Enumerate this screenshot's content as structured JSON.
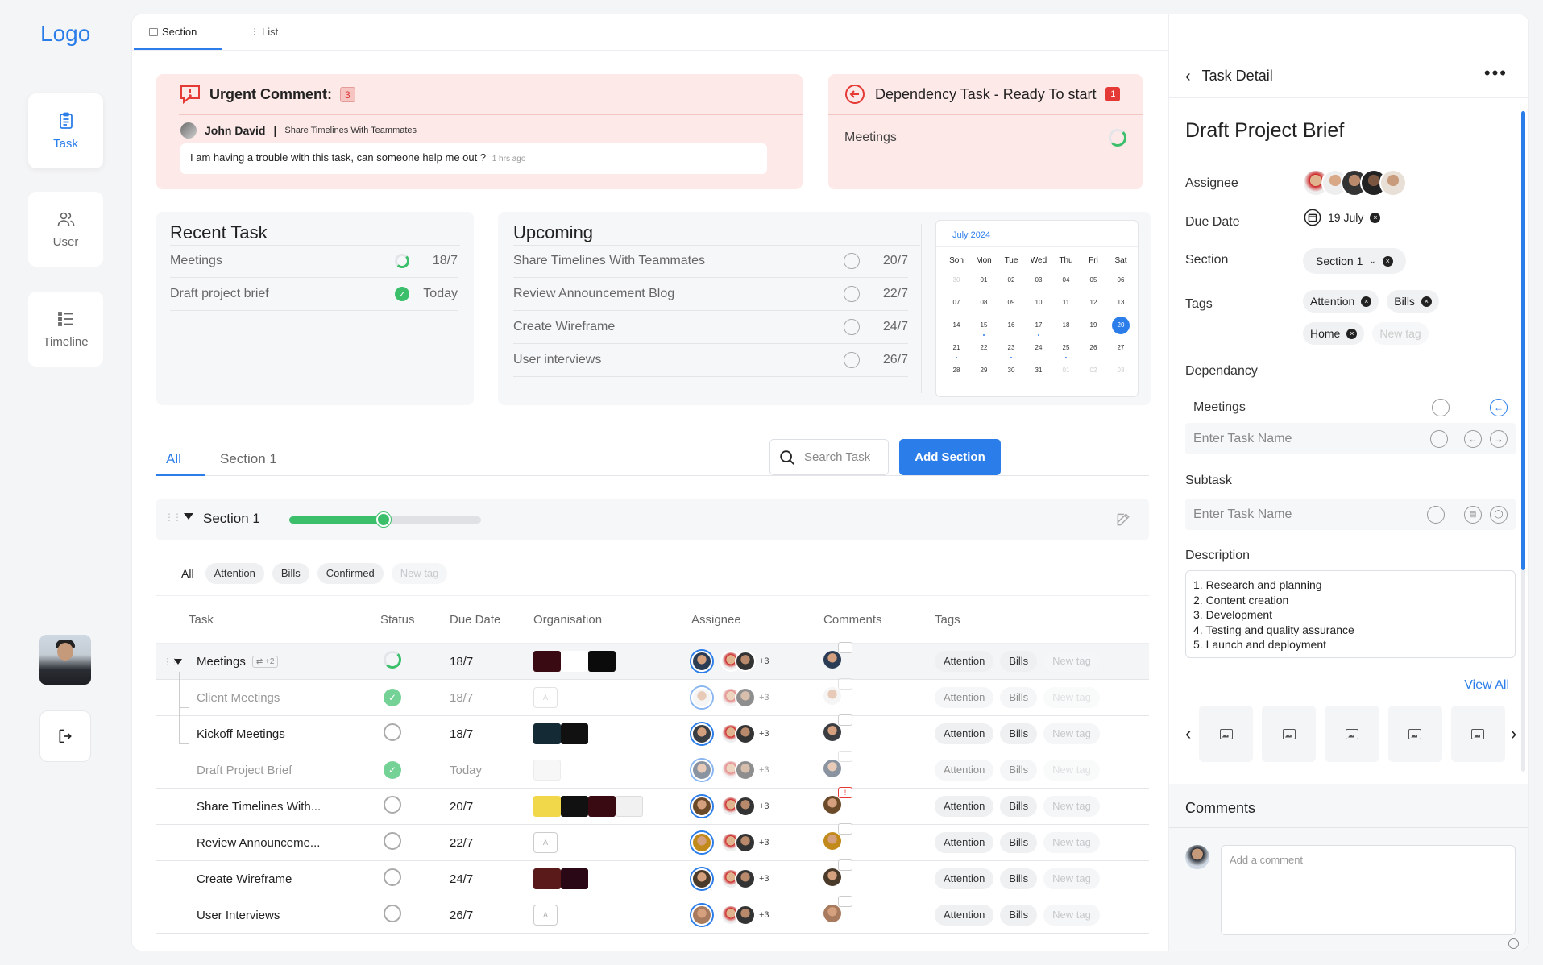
{
  "nav": {
    "logo": "Logo",
    "items": [
      {
        "label": "Task",
        "icon": "clipboard-icon"
      },
      {
        "label": "User",
        "icon": "users-icon"
      },
      {
        "label": "Timeline",
        "icon": "timeline-icon"
      }
    ]
  },
  "topbar": {
    "tabs": [
      {
        "label": "Section"
      },
      {
        "label": "List"
      }
    ]
  },
  "urgent": {
    "title": "Urgent Comment:",
    "count": "3",
    "user": "John David",
    "separator": "|",
    "task": "Share Timelines With Teammates",
    "message": "I am having a trouble with this task, can someone help me out ?",
    "ago": "1 hrs ago"
  },
  "dependency": {
    "title": "Dependency Task - Ready To start",
    "count": "1",
    "item": "Meetings"
  },
  "recent": {
    "title": "Recent Task",
    "items": [
      {
        "name": "Meetings",
        "status": "progress",
        "date": "18/7"
      },
      {
        "name": "Draft project brief",
        "status": "done",
        "date": "Today"
      }
    ]
  },
  "upcoming": {
    "title": "Upcoming",
    "items": [
      {
        "name": "Share Timelines With Teammates",
        "date": "20/7"
      },
      {
        "name": "Review Announcement Blog",
        "date": "22/7"
      },
      {
        "name": "Create Wireframe",
        "date": "24/7"
      },
      {
        "name": "User interviews",
        "date": "26/7"
      }
    ]
  },
  "calendar": {
    "title": "July 2024",
    "weekdays": [
      "Son",
      "Mon",
      "Tue",
      "Wed",
      "Thu",
      "Fri",
      "Sat"
    ],
    "days": [
      "30",
      "01",
      "02",
      "03",
      "04",
      "05",
      "06",
      "07",
      "08",
      "09",
      "10",
      "11",
      "12",
      "13",
      "14",
      "15",
      "16",
      "17",
      "18",
      "19",
      "20",
      "21",
      "22",
      "23",
      "24",
      "25",
      "26",
      "27",
      "28",
      "29",
      "30",
      "31",
      "01",
      "02",
      "03"
    ],
    "selected": "20"
  },
  "tabs": {
    "all": "All",
    "section1": "Section 1"
  },
  "search": {
    "placeholder": "Search Task"
  },
  "add_section": "Add Section",
  "section": {
    "title": "Section 1",
    "progress": 0.49
  },
  "filters": {
    "all": "All",
    "chips": [
      "Attention",
      "Bills",
      "Confirmed",
      "New tag"
    ]
  },
  "table": {
    "columns": [
      "Task",
      "Status",
      "Due Date",
      "Organisation",
      "Assignee",
      "Comments",
      "Tags"
    ],
    "subcount": "+2",
    "more": "+3",
    "tag1": "Attention",
    "tag2": "Bills",
    "tag3": "New tag",
    "rows": [
      {
        "task": "Meetings",
        "date": "18/7"
      },
      {
        "task": "Client Meetings",
        "date": "18/7"
      },
      {
        "task": "Kickoff Meetings",
        "date": "18/7"
      },
      {
        "task": "Draft Project Brief",
        "date": "Today"
      },
      {
        "task": "Share Timelines With...",
        "date": "20/7"
      },
      {
        "task": "Review Announceme...",
        "date": "22/7"
      },
      {
        "task": "Create Wireframe",
        "date": "24/7"
      },
      {
        "task": "User Interviews",
        "date": "26/7"
      }
    ]
  },
  "detail": {
    "header": "Task Detail",
    "title": "Draft Project Brief",
    "assignee_label": "Assignee",
    "due_label": "Due Date",
    "due_value": "19 July",
    "section_label": "Section",
    "section_value": "Section 1",
    "tags_label": "Tags",
    "tags": [
      "Attention",
      "Bills",
      "Home"
    ],
    "new_tag": "New tag",
    "dependency_label": "Dependancy",
    "dependency_item": "Meetings",
    "dependency_placeholder": "Enter Task Name",
    "subtask_label": "Subtask",
    "subtask_placeholder": "Enter Task Name",
    "description_label": "Description",
    "description": [
      "1. Research and planning",
      "2. Content creation",
      "3. Development",
      "4. Testing and quality assurance",
      "5. Launch and deployment"
    ],
    "view_all": "View All",
    "comments_label": "Comments",
    "comment_placeholder": "Add a comment"
  }
}
